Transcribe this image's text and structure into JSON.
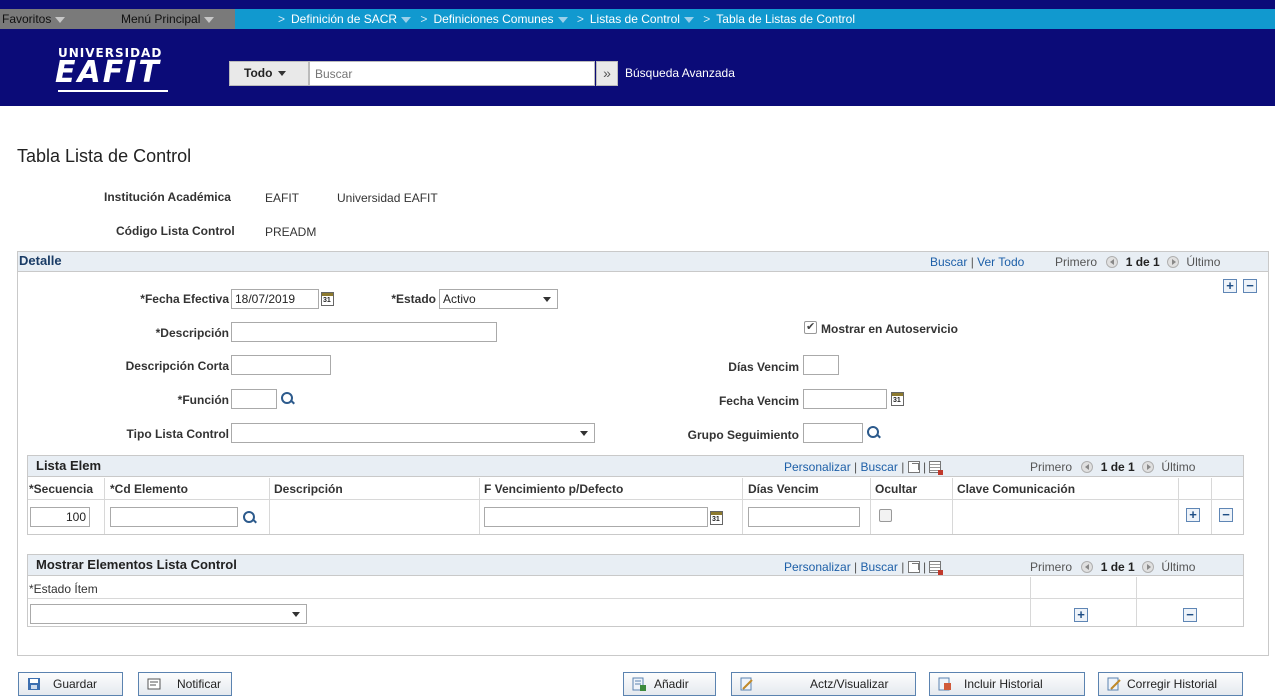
{
  "topnav": {
    "favorites": "Favoritos",
    "main_menu": "Menú Principal",
    "breadcrumbs": [
      {
        "label": "Definición de SACR"
      },
      {
        "label": "Definiciones Comunes"
      },
      {
        "label": "Listas de Control"
      },
      {
        "label": "Tabla de Listas de Control"
      }
    ]
  },
  "brand": {
    "logo_top": "UNIVERSIDAD",
    "logo_main": "EAFIT",
    "search_scope": "Todo",
    "search_placeholder": "Buscar",
    "advanced_search": "Búsqueda Avanzada"
  },
  "page": {
    "title": "Tabla Lista de Control",
    "inst_label": "Institución Académica",
    "inst_code": "EAFIT",
    "inst_name": "Universidad EAFIT",
    "code_label": "Código Lista Control",
    "code_value": "PREADM"
  },
  "detail": {
    "title": "Detalle",
    "find": "Buscar",
    "view_all": "Ver Todo",
    "first": "Primero",
    "count": "1 de 1",
    "last": "Último",
    "effective_date_label": "*Fecha Efectiva",
    "effective_date_value": "18/07/2019",
    "status_label": "*Estado",
    "status_value": "Activo",
    "description_label": "*Descripción",
    "show_self_service_label": "Mostrar en Autoservicio",
    "short_desc_label": "Descripción Corta",
    "due_days_label": "Días Vencim",
    "function_label": "*Función",
    "due_date_label": "Fecha Vencim",
    "checklist_type_label": "Tipo Lista Control",
    "tracking_group_label": "Grupo Seguimiento"
  },
  "items_grid": {
    "title": "Lista Elem",
    "personalize": "Personalizar",
    "find": "Buscar",
    "first": "Primero",
    "count": "1 de 1",
    "last": "Último",
    "columns": [
      "*Secuencia",
      "*Cd Elemento",
      "Descripción",
      "F Vencimiento p/Defecto",
      "Días Vencim",
      "Ocultar",
      "Clave Comunicación"
    ],
    "row": {
      "sequence": "100"
    }
  },
  "status_grid": {
    "title": "Mostrar Elementos Lista Control",
    "personalize": "Personalizar",
    "find": "Buscar",
    "first": "Primero",
    "count": "1 de 1",
    "last": "Último",
    "column": "*Estado Ítem"
  },
  "buttons": {
    "save": "Guardar",
    "notify": "Notificar",
    "add": "Añadir",
    "update": "Actz/Visualizar",
    "include_history": "Incluir Historial",
    "correct_history": "Corregir Historial"
  }
}
